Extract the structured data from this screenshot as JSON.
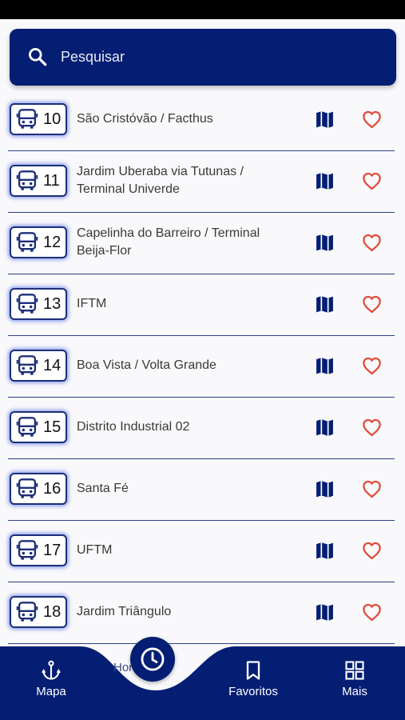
{
  "search": {
    "placeholder": "Pesquisar"
  },
  "routes": [
    {
      "number": "10",
      "name": "São Cristóvão / Facthus"
    },
    {
      "number": "11",
      "name": "Jardim Uberaba via Tutunas / Terminal Univerde"
    },
    {
      "number": "12",
      "name": "Capelinha do Barreiro / Terminal Beija-Flor"
    },
    {
      "number": "13",
      "name": "IFTM"
    },
    {
      "number": "14",
      "name": "Boa Vista / Volta Grande"
    },
    {
      "number": "15",
      "name": "Distrito Industrial 02"
    },
    {
      "number": "16",
      "name": "Santa Fé"
    },
    {
      "number": "17",
      "name": "UFTM"
    },
    {
      "number": "18",
      "name": "Jardim Triângulo"
    }
  ],
  "nav": {
    "mapa": "Mapa",
    "horarios": "Horários",
    "favoritos": "Favoritos",
    "mais": "Mais"
  },
  "colors": {
    "primary": "#041e73",
    "heart": "#e24b3b",
    "divider": "#2a3f86"
  },
  "icons": {
    "search": "search-icon",
    "bus": "bus-icon",
    "map": "map-icon",
    "favorite": "heart-icon",
    "anchor": "anchor-icon",
    "clock": "clock-icon",
    "bookmark": "bookmark-icon",
    "grid": "grid-icon"
  }
}
